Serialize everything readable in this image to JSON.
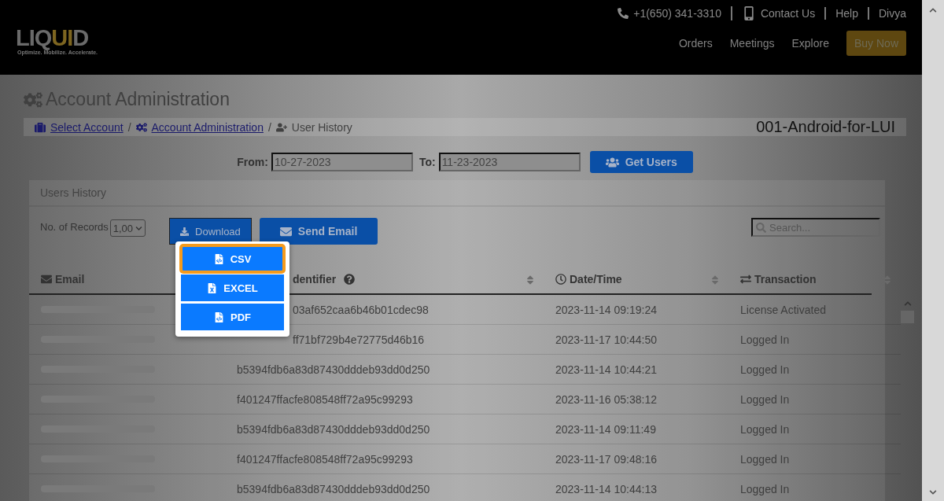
{
  "header": {
    "logo": [
      {
        "text": "LIQ",
        "accent": false
      },
      {
        "text": "UI",
        "accent": true
      },
      {
        "text": "D",
        "accent": false
      }
    ],
    "tagline": "Optimize. Mobilize. Accelerate.",
    "phone": "+1(650) 341-3310",
    "contact": "Contact Us",
    "help": "Help",
    "user": "Divya",
    "nav": [
      "Orders",
      "Meetings",
      "Explore"
    ],
    "buy_button": "Buy Now"
  },
  "page_title": "Account Administration",
  "breadcrumb": [
    {
      "label": "Select Account",
      "kind": "link"
    },
    {
      "separator": "/",
      "label": "Account Administration",
      "kind": "link"
    },
    {
      "separator": "/",
      "label": "User History",
      "kind": "current"
    }
  ],
  "account_name": "001-Android-for-LUI",
  "filter": {
    "from_label": "From:",
    "from": "10-27-2023",
    "to_label": "To:",
    "to": "11-23-2023",
    "button": "Get Users"
  },
  "panel": {
    "title": "Users History",
    "records_label": "No. of Records",
    "records_value": "1,00",
    "download_button": "Download",
    "email_button": "Send Email",
    "search": {
      "placeholder": "Search..."
    },
    "columns": [
      {
        "label": "Email",
        "partly_hidden": false
      },
      {
        "label": "dentifier",
        "partly_hidden": true
      },
      {
        "label": "Date/Time",
        "partly_hidden": false
      },
      {
        "label": "Transaction",
        "partly_hidden": false
      }
    ],
    "rows": [
      {
        "identifier": "03af652caa6b46b01cdec98",
        "partly_hidden": true,
        "datetime": "2023-11-14 09:19:24",
        "transaction": "License Activated"
      },
      {
        "identifier": "ff71bf729b4e72775d46b16",
        "partly_hidden": true,
        "datetime": "2023-11-17 10:44:50",
        "transaction": "Logged In"
      },
      {
        "identifier": "b5394fdb6a83d87430dddeb93dd0d250",
        "partly_hidden": false,
        "datetime": "2023-11-14 10:44:21",
        "transaction": "Logged In"
      },
      {
        "identifier": "f401247ffacfe808548ff72a95c99293",
        "partly_hidden": false,
        "datetime": "2023-11-16 05:38:12",
        "transaction": "Logged In"
      },
      {
        "identifier": "b5394fdb6a83d87430dddeb93dd0d250",
        "partly_hidden": false,
        "datetime": "2023-11-14 09:11:49",
        "transaction": "Logged In"
      },
      {
        "identifier": "f401247ffacfe808548ff72a95c99293",
        "partly_hidden": false,
        "datetime": "2023-11-17 09:48:16",
        "transaction": "Logged In"
      },
      {
        "identifier": "b5394fdb6a83d87430dddeb93dd0d250",
        "partly_hidden": false,
        "datetime": "2023-11-14 10:44:13",
        "transaction": "Logged In"
      }
    ]
  },
  "download_menu": [
    {
      "label": "CSV",
      "kind": "csv",
      "selected": true
    },
    {
      "label": "EXCEL",
      "kind": "excel",
      "selected": false
    },
    {
      "label": "PDF",
      "kind": "pdf",
      "selected": false
    }
  ]
}
